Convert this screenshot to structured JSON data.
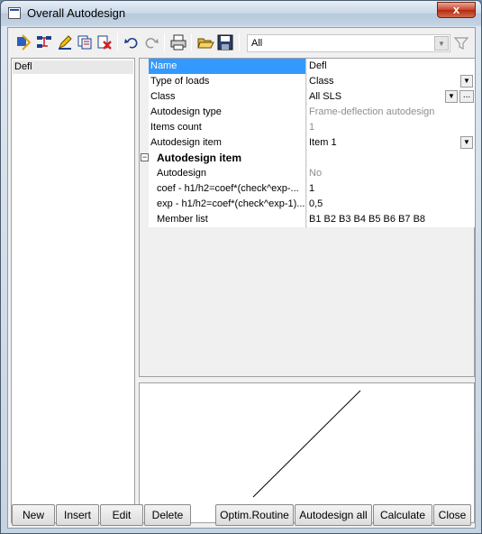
{
  "window": {
    "title": "Overall Autodesign",
    "close_glyph": "x"
  },
  "toolbar": {
    "icons": [
      "autodesign-icon",
      "arrange-icon",
      "edit-pencil-icon",
      "copy-icon",
      "delete-icon",
      "undo-icon",
      "redo-icon",
      "print-icon",
      "open-folder-icon",
      "save-icon"
    ],
    "filter_value": "All",
    "filter_icon": "funnel-icon"
  },
  "list": {
    "items": [
      "Defl"
    ]
  },
  "properties": {
    "rows": [
      {
        "label": "Name",
        "value": "Defl"
      },
      {
        "label": "Type of loads",
        "value": "Class"
      },
      {
        "label": "Class",
        "value": "All SLS"
      },
      {
        "label": "Autodesign type",
        "value": "Frame-deflection autodesign"
      },
      {
        "label": "Items count",
        "value": "1"
      },
      {
        "label": "Autodesign item",
        "value": "Item 1"
      }
    ],
    "group": {
      "label": "Autodesign item",
      "toggle": "−"
    },
    "sub_rows": [
      {
        "label": "Autodesign",
        "value": "No"
      },
      {
        "label": "coef - h1/h2=coef*(check^exp-...",
        "value": "1"
      },
      {
        "label": "exp - h1/h2=coef*(check^exp-1)...",
        "value": "0,5"
      },
      {
        "label": "Member list",
        "value": "B1 B2 B3 B4 B5 B6 B7 B8"
      }
    ],
    "ellipsis": "..."
  },
  "buttons": {
    "new": "New",
    "insert": "Insert",
    "edit": "Edit",
    "delete": "Delete",
    "optim": "Optim.Routine",
    "autodesign_all": "Autodesign all",
    "calculate": "Calculate",
    "close": "Close"
  }
}
